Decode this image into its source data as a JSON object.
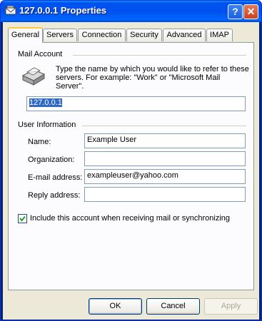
{
  "window": {
    "title": "127.0.0.1 Properties"
  },
  "tabs": [
    "General",
    "Servers",
    "Connection",
    "Security",
    "Advanced",
    "IMAP"
  ],
  "mail_account": {
    "group_label": "Mail Account",
    "description_line1": "Type the name by which you would like to refer to these",
    "description_line2": "servers.  For example: \"Work\" or \"Microsoft Mail",
    "description_line3": "Server\".",
    "account_name": "127.0.0.1"
  },
  "user_info": {
    "group_label": "User Information",
    "name_label": "Name:",
    "name_value": "Example User",
    "organization_label": "Organization:",
    "organization_value": "",
    "email_label": "E-mail address:",
    "email_value": "exampleuser@yahoo.com",
    "reply_label": "Reply address:",
    "reply_value": ""
  },
  "include_checkbox": {
    "label": "Include this account when receiving mail or synchronizing",
    "checked": true
  },
  "buttons": {
    "ok": "OK",
    "cancel": "Cancel",
    "apply": "Apply"
  }
}
